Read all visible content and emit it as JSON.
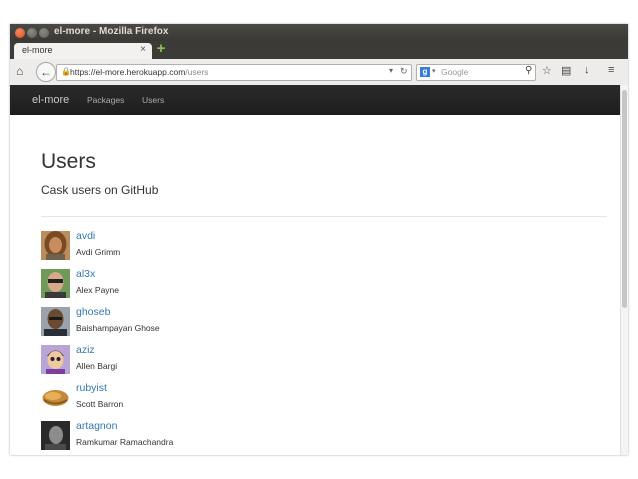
{
  "window": {
    "title": "el-more - Mozilla Firefox"
  },
  "tabs": [
    {
      "title": "el-more"
    }
  ],
  "address": {
    "url_host": "https://el-more.herokuapp.com",
    "url_path": "/users"
  },
  "search": {
    "placeholder": "Google"
  },
  "site": {
    "brand": "el-more",
    "nav": [
      "Packages",
      "Users"
    ]
  },
  "page": {
    "title": "Users",
    "subtitle": "Cask users on GitHub"
  },
  "users": [
    {
      "login": "avdi",
      "name": "Avdi Grimm"
    },
    {
      "login": "al3x",
      "name": "Alex Payne"
    },
    {
      "login": "ghoseb",
      "name": "Baishampayan Ghose"
    },
    {
      "login": "aziz",
      "name": "Allen Bargi"
    },
    {
      "login": "rubyist",
      "name": "Scott Barron"
    },
    {
      "login": "artagnon",
      "name": "Ramkumar Ramachandra"
    }
  ],
  "icons": {
    "home": "home-icon",
    "back": "back-arrow-icon",
    "lock": "lock-icon",
    "reload": "reload-icon",
    "search": "magnifier-icon",
    "bookmark": "star-icon",
    "bookmarks_menu": "bookmarks-list-icon",
    "downloads": "download-icon",
    "menu": "hamburger-menu-icon"
  },
  "colors": {
    "link": "#3478b2",
    "site_nav_bg": "#222222",
    "titlebar_bg": "#3c3b37"
  }
}
